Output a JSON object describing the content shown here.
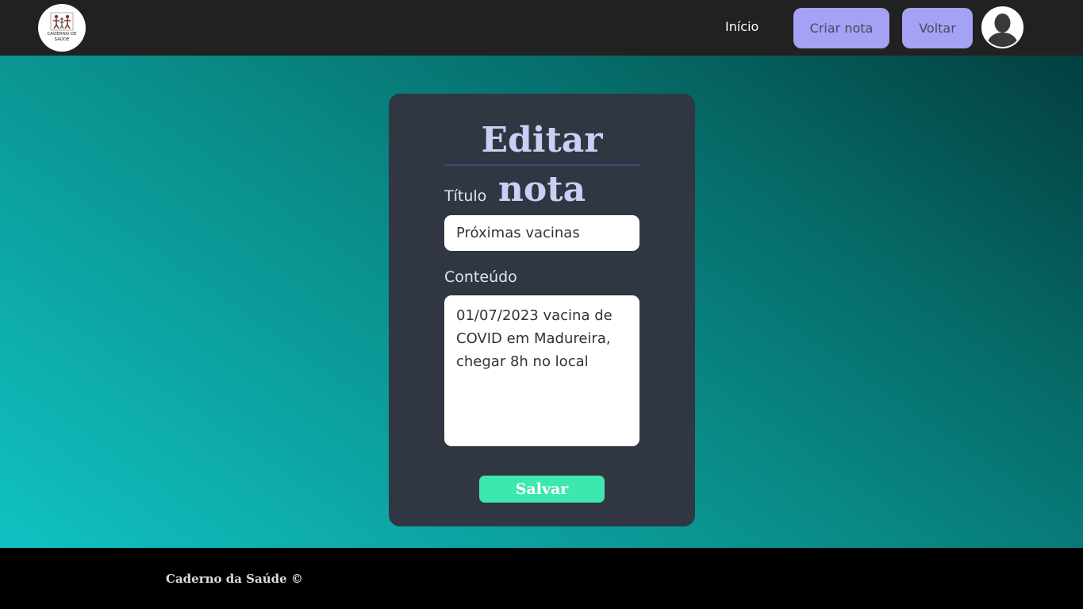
{
  "header": {
    "logo_text": "CADERNO DE SAÚDE",
    "nav": {
      "home_label": "Início",
      "create_note_label": "Criar nota",
      "back_label": "Voltar"
    },
    "avatar_icon": "user-avatar-icon"
  },
  "form": {
    "title": "Editar nota",
    "title_field": {
      "label": "Título",
      "value": "Próximas vacinas"
    },
    "content_field": {
      "label": "Conteúdo",
      "value": "01/07/2023 vacina de COVID em Madureira, chegar 8h no local"
    },
    "save_label": "Salvar"
  },
  "footer": {
    "text": "Caderno da Saúde ©"
  },
  "colors": {
    "topbar": "#212121",
    "nav_button": "#a5a1f5",
    "card": "#313643",
    "save_button": "#3de8b0",
    "title": "#c9d0f5"
  }
}
